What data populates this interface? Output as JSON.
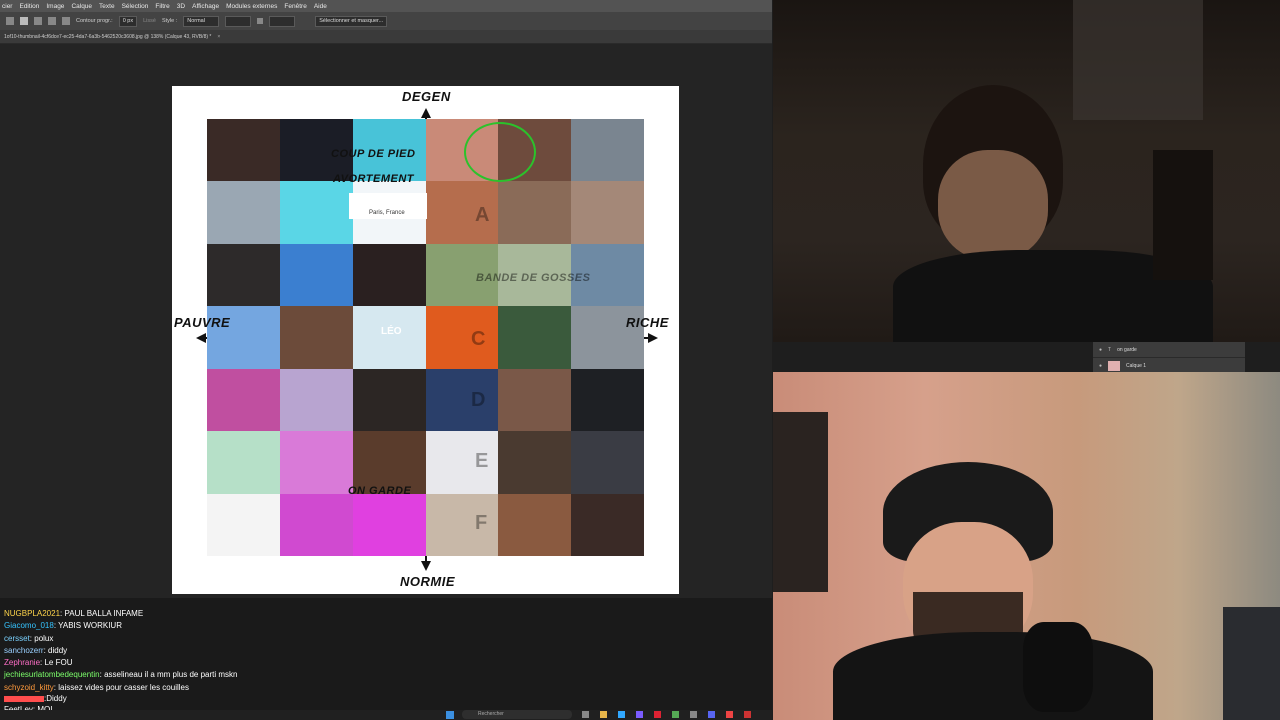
{
  "menubar": {
    "items": [
      "cier",
      "Edition",
      "Image",
      "Calque",
      "Texte",
      "Sélection",
      "Filtre",
      "3D",
      "Affichage",
      "Modules externes",
      "Fenêtre",
      "Aide"
    ]
  },
  "options": {
    "contour_label": "Contour progr.:",
    "contour_value": "0 px",
    "lisse_label": "Lissé",
    "style_label": "Style :",
    "style_value": "Normal",
    "select_mask_button": "Sélectionner et masquer..."
  },
  "document_tab": {
    "title": "1of10-thumbnail-4cf6dce7-ec25-4da7-6a3b-5462520c3608.jpg @ 138% (Calque 43, RVB/8) *"
  },
  "alignment_chart": {
    "top_axis": "DEGEN",
    "bottom_axis": "NORMIE",
    "left_axis": "PAUVRE",
    "right_axis": "RICHE",
    "labels": {
      "coup_de_pied": "COUP DE PIED",
      "avortement": "AVORTEMENT",
      "on_garde": "ON GARDE",
      "bande_de_gosses": "BANDE DE GOSSES",
      "leo": "LÉO",
      "location": "Paris, France",
      "row_letters": [
        "A",
        "C",
        "D",
        "E",
        "F"
      ]
    }
  },
  "chat": {
    "messages": [
      {
        "user": "NUGBPLA2021",
        "text": "PAUL BALLA INFAME",
        "color": "#ffd54a"
      },
      {
        "user": "Giacomo_018",
        "text": "YABIS WORKIUR",
        "color": "#35c4ff"
      },
      {
        "user": "cersset",
        "text": "polux",
        "color": "#7bd2ff"
      },
      {
        "user": "sanchozerr",
        "text": "diddy",
        "color": "#9ad0ff"
      },
      {
        "user": "Zephranie",
        "text": "Le FOU",
        "color": "#ff6ec7"
      },
      {
        "user": "jechiesurlatombedequentin",
        "text": "asselineau il a mm plus de parti mskn",
        "color": "#7cff6b"
      },
      {
        "user": "schyzoid_kitty",
        "text": "laissez vides pour casser les couilles",
        "color": "#ff9a3d"
      },
      {
        "user": "",
        "text": "Diddy",
        "color": "#ff4d4d"
      },
      {
        "user": "FeetLey",
        "text": "MOI",
        "color": "#ffffff"
      }
    ]
  },
  "layers": {
    "items": [
      "on garde",
      "Calque 1"
    ]
  },
  "taskbar": {
    "search_placeholder": "Rechercher"
  }
}
